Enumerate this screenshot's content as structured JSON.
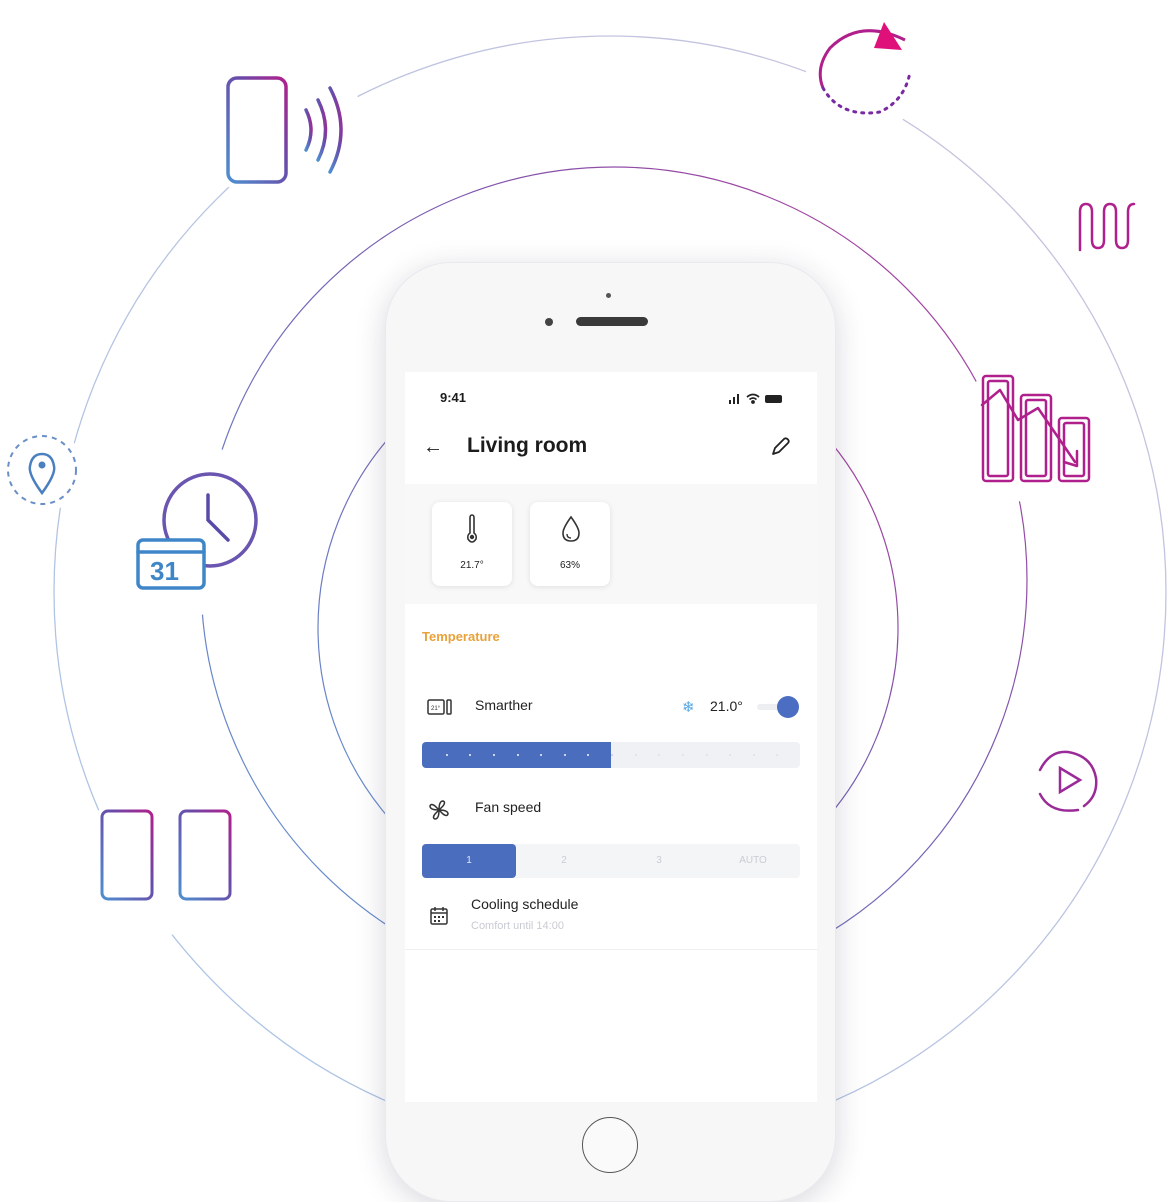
{
  "status_bar": {
    "time": "9:41"
  },
  "header": {
    "title": "Living room"
  },
  "sensors": [
    {
      "icon": "thermometer-icon",
      "value": "21.7°"
    },
    {
      "icon": "humidity-drop-icon",
      "value": "63%"
    }
  ],
  "section": {
    "title": "Temperature"
  },
  "device": {
    "name": "Smarther",
    "mode_icon": "snowflake-icon",
    "setpoint": "21.0°",
    "power_on": true
  },
  "temperature_slider": {
    "level_fraction": 0.5
  },
  "fan": {
    "label": "Fan speed",
    "options": [
      "1",
      "2",
      "3",
      "AUTO"
    ],
    "selected_index": 0
  },
  "schedule": {
    "title": "Cooling schedule",
    "subtitle": "Comfort until 14:00"
  },
  "theme": {
    "accent_blue": "#4a6dbd",
    "section_orange": "#e8a23a",
    "ring_gradient_start": "#4f8fd0",
    "ring_gradient_end": "#b0208c"
  },
  "feature_icons": [
    "phone-wireless-icon",
    "sync-arrow-icon",
    "heating-radiator-icon",
    "location-pin-icon",
    "calendar-clock-icon",
    "energy-savings-chart-icon",
    "play-icon",
    "add-device-icon"
  ]
}
